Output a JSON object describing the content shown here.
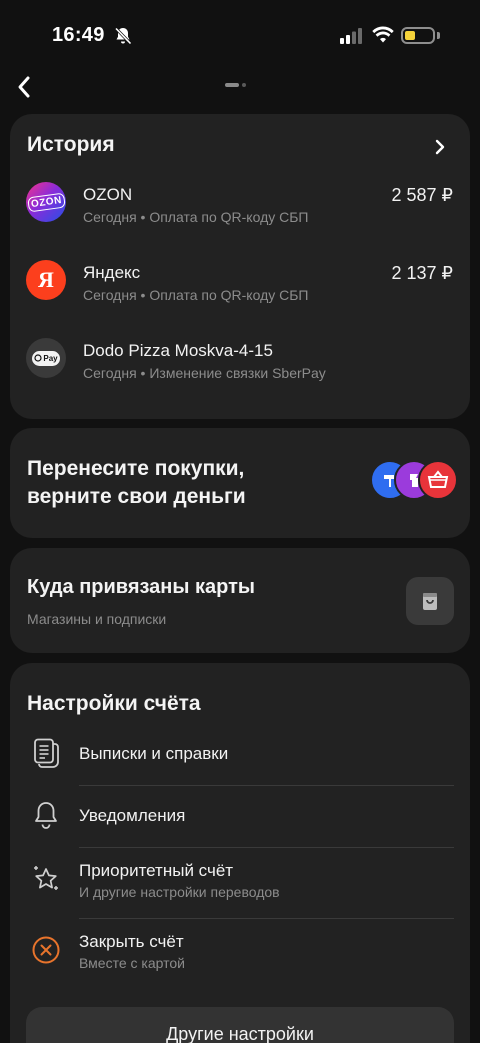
{
  "status_bar": {
    "time": "16:49"
  },
  "history": {
    "title": "История",
    "transactions": [
      {
        "name": "OZON",
        "logo_text": "OZON",
        "subtitle": "Сегодня • Оплата по QR-коду СБП",
        "amount": "2 587 ₽"
      },
      {
        "name": "Яндекс",
        "logo_text": "Я",
        "subtitle": "Сегодня • Оплата по QR-коду СБП",
        "amount": "2 137 ₽"
      },
      {
        "name": "Dodo Pizza Moskva-4-15",
        "logo_text": "Pay",
        "subtitle": "Сегодня • Изменение связки SberPay",
        "amount": ""
      }
    ]
  },
  "refund_banner": {
    "line1": "Перенесите покупки,",
    "line2": "верните свои деньги"
  },
  "cards_link": {
    "title": "Куда привязаны карты",
    "subtitle": "Магазины и подписки"
  },
  "settings": {
    "title": "Настройки счёта",
    "items": [
      {
        "label": "Выписки и справки",
        "subtitle": ""
      },
      {
        "label": "Уведомления",
        "subtitle": ""
      },
      {
        "label": "Приоритетный счёт",
        "subtitle": "И другие настройки переводов"
      },
      {
        "label": "Закрыть счёт",
        "subtitle": "Вместе с картой"
      }
    ],
    "more_button": "Другие настройки"
  },
  "colors": {
    "background": "#111111",
    "card": "#222222",
    "accent_orange": "#e8742c",
    "battery": "#f5d33a"
  },
  "icons": {
    "back": "chevron-left-icon",
    "history_more": "chevron-right-icon",
    "statements": "documents-icon",
    "notifications": "bell-icon",
    "priority": "star-icon",
    "close_account": "close-circle-icon",
    "cards_link": "bag-icon"
  }
}
